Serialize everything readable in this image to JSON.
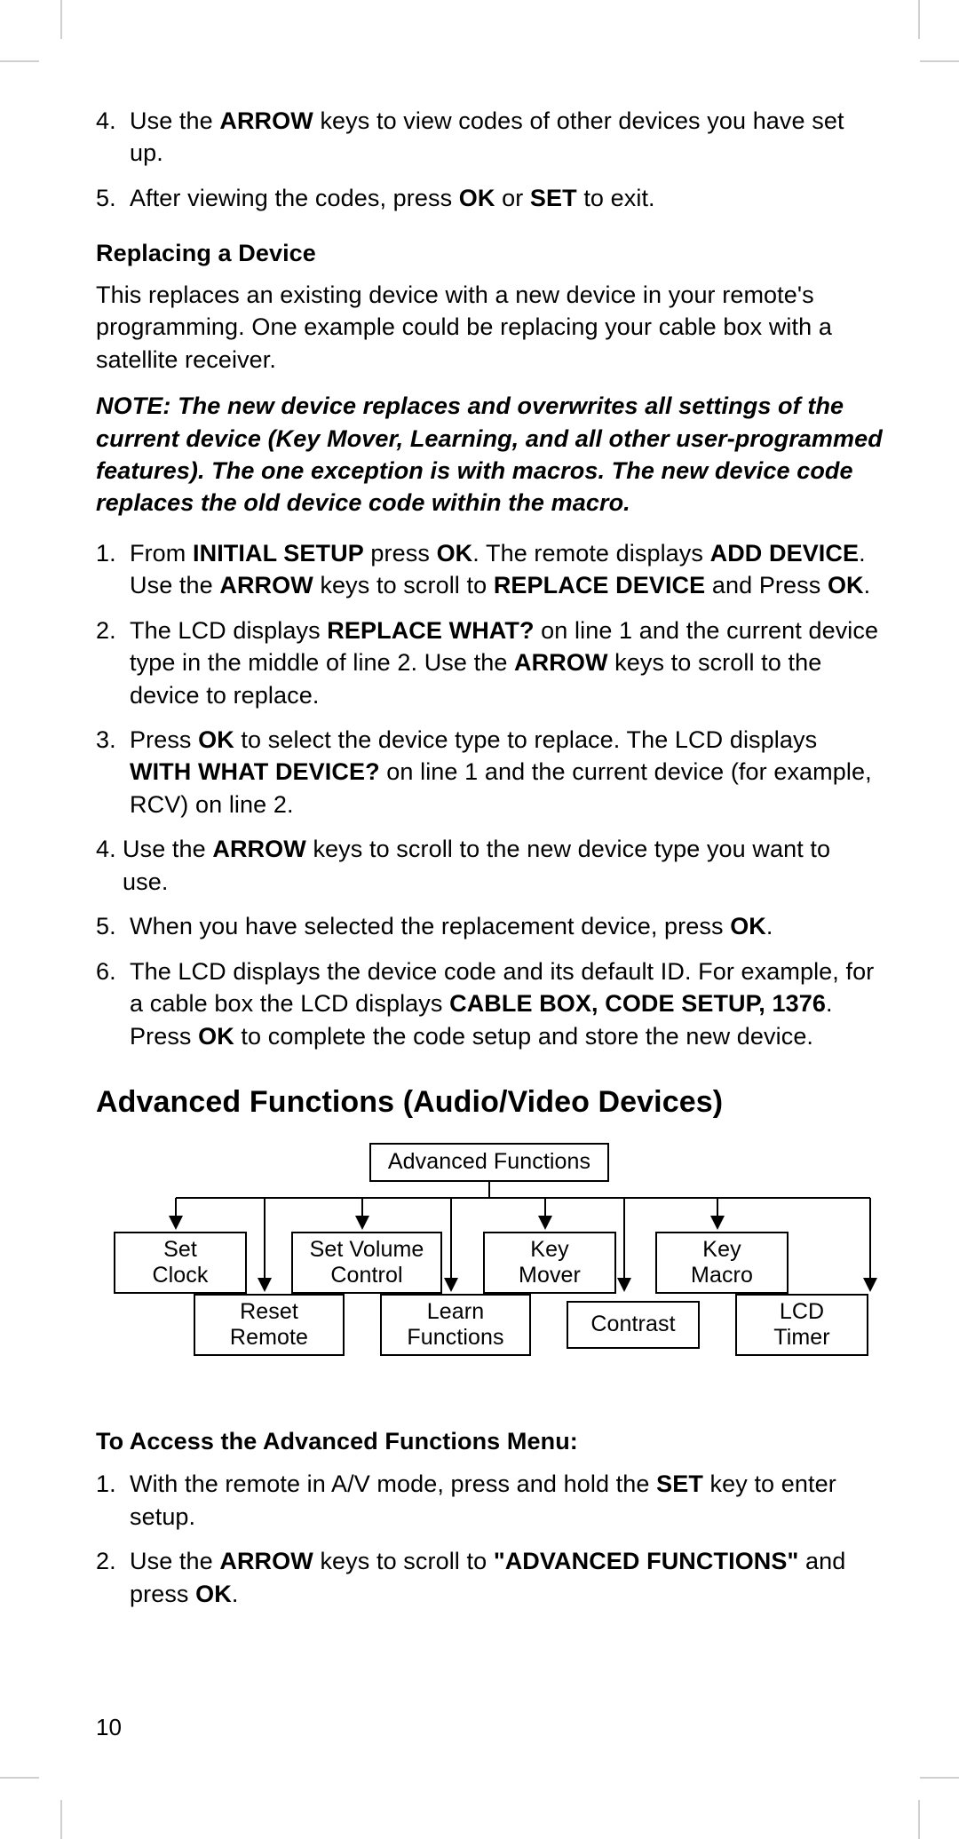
{
  "top_list": [
    {
      "n": "4.",
      "segments": [
        {
          "t": "Use the "
        },
        {
          "t": "ARROW",
          "b": true
        },
        {
          "t": " keys to view codes of other devices you have set up."
        }
      ]
    },
    {
      "n": "5.",
      "segments": [
        {
          "t": "After viewing the codes, press "
        },
        {
          "t": "OK",
          "b": true
        },
        {
          "t": " or "
        },
        {
          "t": "SET",
          "b": true
        },
        {
          "t": " to exit."
        }
      ]
    }
  ],
  "replace_heading": "Replacing a Device",
  "replace_para": "This replaces an existing device with a new device in your remote's programming. One example could be replacing your cable box with a satellite receiver.",
  "replace_note_segments": [
    {
      "t": "NOTE: The new device replaces and overwrites all settings of the current device (Key Mover, Learning, and all other user-programmed features). The one exception is with macros. The new device code replaces the old device code within the macro.",
      "bi": true
    }
  ],
  "replace_list": [
    {
      "n": "1.",
      "segments": [
        {
          "t": "From "
        },
        {
          "t": "INITIAL SETUP",
          "b": true
        },
        {
          "t": " press "
        },
        {
          "t": "OK",
          "b": true
        },
        {
          "t": ". The remote displays "
        },
        {
          "t": "ADD DEVICE",
          "b": true
        },
        {
          "t": ". Use the "
        },
        {
          "t": "ARROW",
          "b": true
        },
        {
          "t": " keys to scroll to "
        },
        {
          "t": "REPLACE DEVICE",
          "b": true
        },
        {
          "t": " and Press "
        },
        {
          "t": "OK",
          "b": true
        },
        {
          "t": "."
        }
      ]
    },
    {
      "n": "2.",
      "segments": [
        {
          "t": "The LCD displays "
        },
        {
          "t": "REPLACE WHAT?",
          "b": true
        },
        {
          "t": " on line 1 and the current device type in the middle of line 2. Use the "
        },
        {
          "t": "ARROW",
          "b": true
        },
        {
          "t": " keys to scroll to the device to replace."
        }
      ]
    },
    {
      "n": "3.",
      "segments": [
        {
          "t": "Press "
        },
        {
          "t": "OK",
          "b": true
        },
        {
          "t": " to select the device type to replace. The LCD displays "
        },
        {
          "t": "WITH WHAT DEVICE?",
          "b": true
        },
        {
          "t": " on line 1 and the current device (for example, RCV) on line 2."
        }
      ]
    },
    {
      "n": "4.",
      "segments": [
        {
          "t": "Use the "
        },
        {
          "t": "ARROW",
          "b": true
        },
        {
          "t": " keys to scroll to the new device type you want to use."
        }
      ],
      "pad": "30"
    },
    {
      "n": "5.",
      "segments": [
        {
          "t": "When you have selected the replacement device, press "
        },
        {
          "t": "OK",
          "b": true
        },
        {
          "t": "."
        }
      ]
    },
    {
      "n": "6.",
      "segments": [
        {
          "t": "The LCD displays the device code and its default ID. For example, for a cable box the LCD displays "
        },
        {
          "t": "CABLE BOX, CODE SETUP, 1376",
          "b": true
        },
        {
          "t": ". Press "
        },
        {
          "t": "OK",
          "b": true
        },
        {
          "t": " to complete the code setup and store the new device."
        }
      ]
    }
  ],
  "section_title": "Advanced Functions (Audio/Video Devices)",
  "diagram": {
    "root": "Advanced Functions",
    "row1": [
      "Set\nClock",
      "Set Volume\nControl",
      "Key\nMover",
      "Key\nMacro"
    ],
    "row2": [
      "Reset\nRemote",
      "Learn\nFunctions",
      "Contrast",
      "LCD\nTimer"
    ]
  },
  "access_heading": "To Access the Advanced Functions Menu:",
  "access_list": [
    {
      "n": "1.",
      "segments": [
        {
          "t": "With the remote in A/V mode, press and hold the "
        },
        {
          "t": "SET",
          "b": true
        },
        {
          "t": " key to enter setup."
        }
      ]
    },
    {
      "n": "2.",
      "segments": [
        {
          "t": "Use the "
        },
        {
          "t": "ARROW",
          "b": true
        },
        {
          "t": " keys to scroll to "
        },
        {
          "t": "\"ADVANCED FUNCTIONS\"",
          "b": true
        },
        {
          "t": " and press "
        },
        {
          "t": "OK",
          "b": true
        },
        {
          "t": "."
        }
      ]
    }
  ],
  "page_number": "10"
}
